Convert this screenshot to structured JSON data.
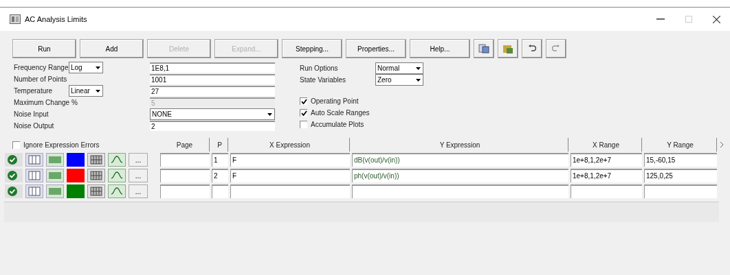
{
  "window": {
    "title": "AC Analysis Limits"
  },
  "toolbar": {
    "buttons": [
      {
        "label": "Run",
        "disabled": false
      },
      {
        "label": "Add",
        "disabled": false
      },
      {
        "label": "Delete",
        "disabled": true
      },
      {
        "label": "Expand...",
        "disabled": true
      },
      {
        "label": "Stepping...",
        "disabled": false
      },
      {
        "label": "Properties...",
        "disabled": false
      },
      {
        "label": "Help...",
        "disabled": false
      }
    ]
  },
  "form": {
    "left": [
      {
        "kind": "combo_text",
        "label": "Frequency Range",
        "option": "Log",
        "value": "1E8,1",
        "disabled": false
      },
      {
        "kind": "text",
        "label": "Number of Points",
        "value": "1001",
        "disabled": false
      },
      {
        "kind": "combo_text",
        "label": "Temperature",
        "option": "Linear",
        "value": "27",
        "disabled": false
      },
      {
        "kind": "text",
        "label": "Maximum Change %",
        "value": "5",
        "disabled": true
      },
      {
        "kind": "select",
        "label": "Noise Input",
        "value": "NONE",
        "disabled": false
      },
      {
        "kind": "text",
        "label": "Noise Output",
        "value": "2",
        "disabled": false
      }
    ],
    "right_selects": [
      {
        "label": "Run Options",
        "value": "Normal"
      },
      {
        "label": "State Variables",
        "value": "Zero"
      }
    ],
    "checkboxes": [
      {
        "label": "Operating Point",
        "checked": true
      },
      {
        "label": "Auto Scale Ranges",
        "checked": true
      },
      {
        "label": "Accumulate Plots",
        "checked": false
      }
    ]
  },
  "table": {
    "ignore_errors": {
      "label": "Ignore Expression Errors",
      "checked": false
    },
    "columns": [
      "Page",
      "P",
      "X Expression",
      "Y Expression",
      "X Range",
      "Y Range"
    ],
    "rows": [
      {
        "color": "#0000ff",
        "more": "...",
        "p": "1",
        "x_expression": "F",
        "y_expression": "dB(v(out)/v(in))",
        "x_range": "1e+8,1,2e+7",
        "y_range": "15,-60,15"
      },
      {
        "color": "#ff0000",
        "more": "...",
        "p": "2",
        "x_expression": "F",
        "y_expression": "ph(v(out)/v(in))",
        "x_range": "1e+8,1,2e+7",
        "y_range": "125,0,25"
      },
      {
        "color": "#008000",
        "more": "..."
      }
    ]
  }
}
